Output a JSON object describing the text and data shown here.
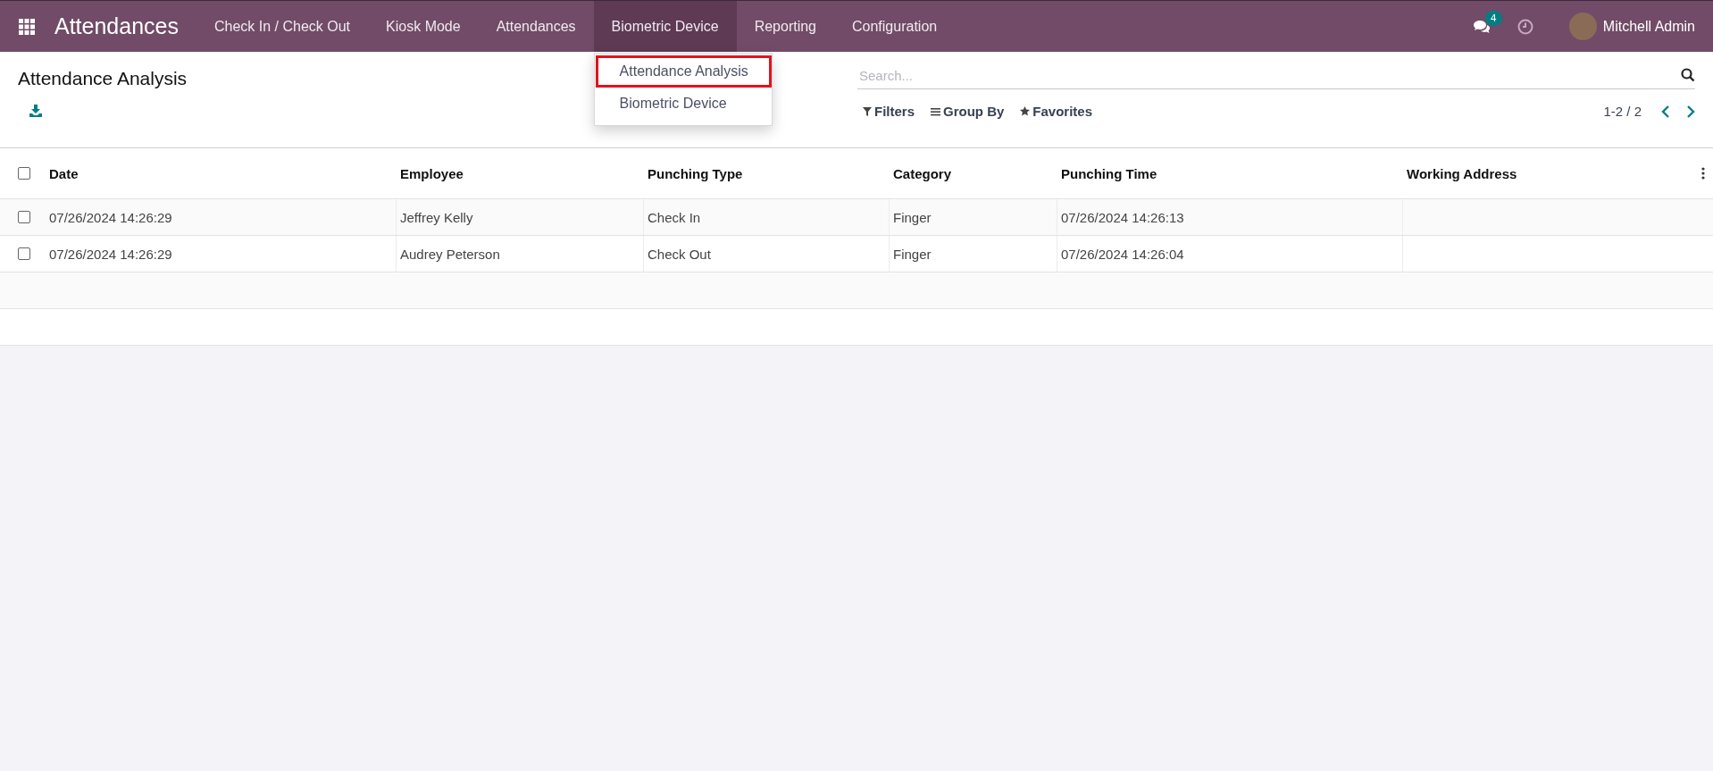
{
  "navbar": {
    "app_name": "Attendances",
    "menu": [
      {
        "label": "Check In / Check Out",
        "open": false
      },
      {
        "label": "Kiosk Mode",
        "open": false
      },
      {
        "label": "Attendances",
        "open": false
      },
      {
        "label": "Biometric Device",
        "open": true
      },
      {
        "label": "Reporting",
        "open": false
      },
      {
        "label": "Configuration",
        "open": false
      }
    ],
    "messages_badge": "4",
    "user": "Mitchell Admin"
  },
  "dropdown": {
    "items": [
      {
        "label": "Attendance Analysis",
        "highlighted": true
      },
      {
        "label": "Biometric Device",
        "highlighted": false
      }
    ]
  },
  "control_panel": {
    "title": "Attendance Analysis",
    "search": {
      "placeholder": "Search..."
    },
    "filters": [
      "Filters",
      "Group By",
      "Favorites"
    ],
    "pager": "1-2 / 2"
  },
  "table": {
    "select_all_checked": false,
    "columns": [
      "Date",
      "Employee",
      "Punching Type",
      "Category",
      "Punching Time",
      "Working Address"
    ],
    "rows": [
      {
        "checked": false,
        "cells": [
          "07/26/2024 14:26:29",
          "Jeffrey Kelly",
          "Check In",
          "Finger",
          "07/26/2024 14:26:13",
          ""
        ]
      },
      {
        "checked": false,
        "cells": [
          "07/26/2024 14:26:29",
          "Audrey Peterson",
          "Check Out",
          "Finger",
          "07/26/2024 14:26:04",
          ""
        ]
      }
    ]
  }
}
